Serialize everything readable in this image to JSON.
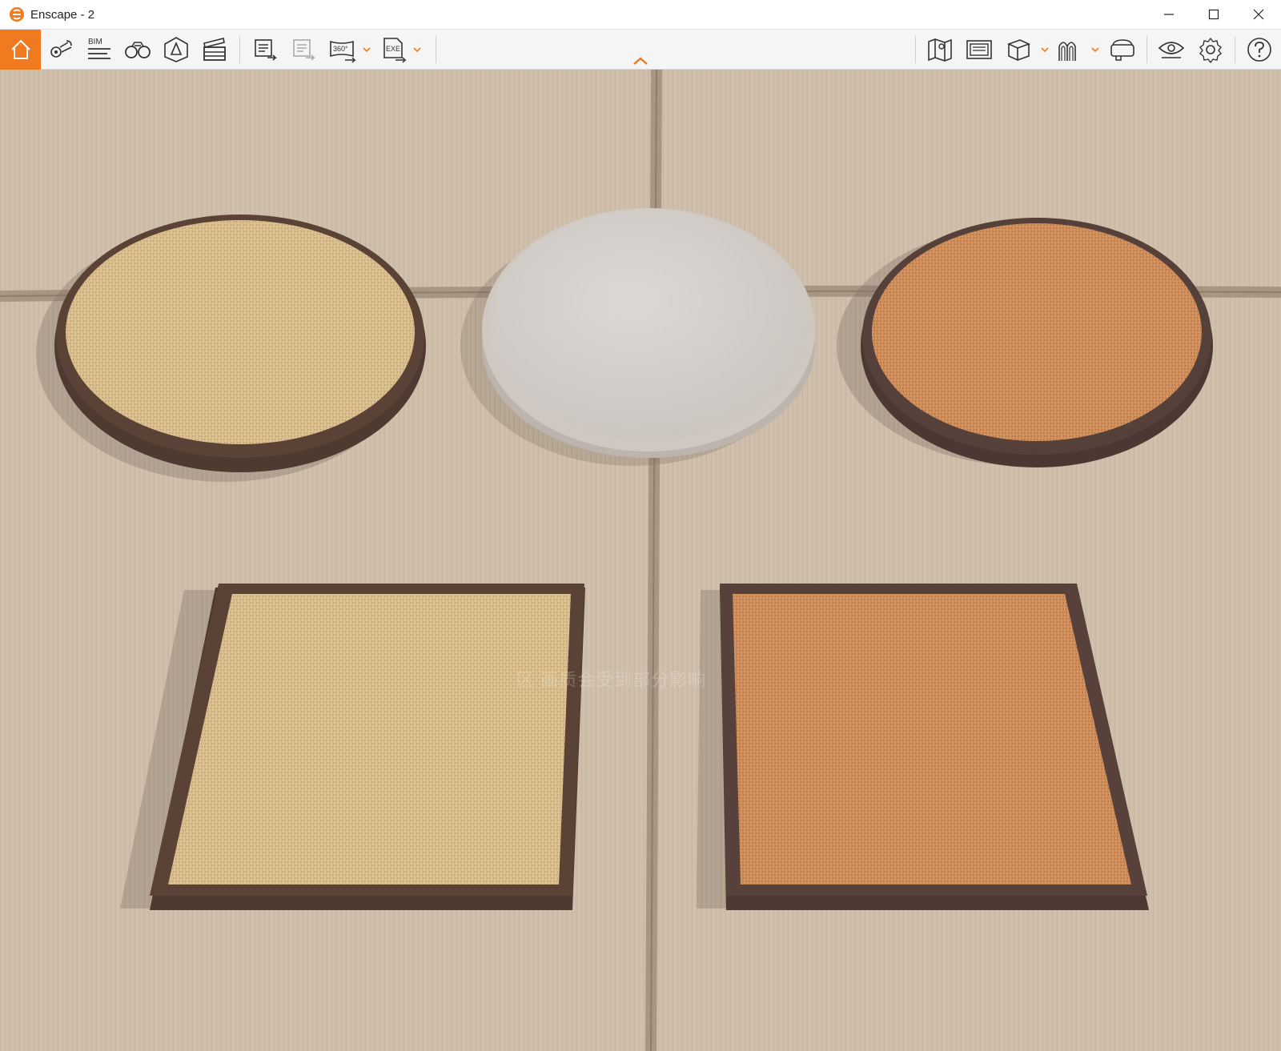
{
  "window": {
    "title": "Enscape - 2",
    "controls": [
      "minimize",
      "maximize",
      "close"
    ]
  },
  "toolbar": {
    "left_tools": [
      {
        "name": "home",
        "icon": "home-icon",
        "active": true
      },
      {
        "name": "views",
        "icon": "map-pin-views-icon"
      },
      {
        "name": "bim",
        "icon": "bim-icon",
        "label": "BIM"
      },
      {
        "name": "visual-settings",
        "icon": "binoculars-icon"
      },
      {
        "name": "assets",
        "icon": "asset-library-icon"
      },
      {
        "name": "video-editor",
        "icon": "clapperboard-icon"
      },
      {
        "name": "batch-render",
        "icon": "batch-render-icon"
      },
      {
        "name": "web-standalone",
        "icon": "web-export-icon"
      },
      {
        "name": "panorama",
        "icon": "panorama-icon",
        "label": "360°"
      },
      {
        "name": "export-exe",
        "icon": "exe-export-icon",
        "label": "EXE"
      }
    ],
    "right_tools": [
      {
        "name": "minimap",
        "icon": "map-icon"
      },
      {
        "name": "screenshot",
        "icon": "screenshot-icon"
      },
      {
        "name": "view-cube",
        "icon": "cube-icon"
      },
      {
        "name": "sun-path",
        "icon": "arches-icon"
      },
      {
        "name": "vr-headset",
        "icon": "vr-headset-icon"
      },
      {
        "name": "visibility",
        "icon": "eye-icon"
      },
      {
        "name": "settings",
        "icon": "gear-icon"
      },
      {
        "name": "help",
        "icon": "help-icon"
      }
    ],
    "accent_color": "#f07a20"
  },
  "viewport": {
    "watermark_text": "区  画质会受到部分影响",
    "floor_color": "#cdbda9",
    "cushions": [
      {
        "name": "round-cushion-beige-weave",
        "shape": "round",
        "top_color": "#d9bd8c",
        "rim_color": "#5b4236"
      },
      {
        "name": "round-cushion-grey-fabric",
        "shape": "round",
        "top_color": "#d4cfcb",
        "rim_color": "#c9c2bb"
      },
      {
        "name": "round-cushion-orange-weave",
        "shape": "round",
        "top_color": "#cf8d5a",
        "rim_color": "#55403a"
      },
      {
        "name": "square-cushion-beige-weave",
        "shape": "square",
        "top_color": "#d7bb89",
        "rim_color": "#5b4236"
      },
      {
        "name": "square-cushion-orange-weave",
        "shape": "square",
        "top_color": "#cf8c59",
        "rim_color": "#57413a"
      }
    ]
  }
}
